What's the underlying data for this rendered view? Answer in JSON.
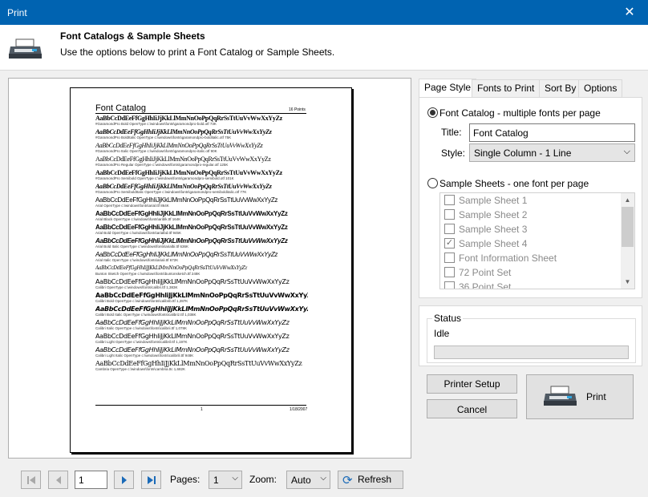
{
  "window": {
    "title": "Print"
  },
  "header": {
    "title": "Font Catalogs & Sample Sheets",
    "subtitle": "Use the options below to print a Font Catalog or Sample Sheets."
  },
  "preview": {
    "catalog_title": "Font Catalog",
    "catalog_points": "16 Points",
    "footer_page": "1",
    "footer_date": "1/18/2007",
    "entries": [
      {
        "sample": "AaBbCcDdEeFfGgHhIiJjKkLlMmNnOoPpQqRrSsTtUuVvWwXxYyZz",
        "meta": "#GaramondPro Bold    OpenType    c:\\windows\\fonts\\garamondpro-bold.otf    73K"
      },
      {
        "sample": "AaBbCcDdEeFfGgHhIiJjKkLlMmNnOoPpQqRrSsTtUuVvWwXxYyZz",
        "meta": "#GaramondPro BoldItalic    OpenType    c:\\windows\\fonts\\garamondpro-bolditalic.otf    75K"
      },
      {
        "sample": "AaBbCcDdEeFfGgHhIiJjKkLlMmNnOoPpQqRrSsTtUuVvWwXxYyZz",
        "meta": "#GaramondPro Italic    OpenType    c:\\windows\\fonts\\garamondpro-italic.otf    90K"
      },
      {
        "sample": "AaBbCcDdEeFfGgHhIiJjKkLlMmNnOoPpQqRrSsTtUuVvWwXxYyZz",
        "meta": "#GaramondPro Regular    OpenType    c:\\windows\\fonts\\garamondpro-regular.otf    125K"
      },
      {
        "sample": "AaBbCcDdEeFfGgHhIiJjKkLlMmNnOoPpQqRrSsTtUuVvWwXxYyZz",
        "meta": "#GaramondPro Semibold    OpenType    c:\\windows\\fonts\\garamondpro-semibold.otf    101K"
      },
      {
        "sample": "AaBbCcDdEeFfGgHhIiJjKkLlMmNnOoPpQqRrSsTtUuVvWwXxYyZz",
        "meta": "#GaramondPro SemiboldItalic    OpenType    c:\\windows\\fonts\\garamondpro-semibolditalic.otf    77K"
      },
      {
        "sample": "AaBbCcDdEeFfGgHhIiJjKkLlMmNnOoPpQqRrSsTtUuVvWwXxYyZz",
        "meta": "Arial    OpenType    c:\\windows\\fonts\\arial.ttf    864K"
      },
      {
        "sample": "AaBbCcDdEeFfGgHhIiJjKkLlMmNnOoPpQqRrSsTtUuVvWwXxYyZz",
        "meta": "Arial Black    OpenType    c:\\windows\\fonts\\ariblk.ttf    164K"
      },
      {
        "sample": "AaBbCcDdEeFfGgHhIiJjKkLlMmNnOoPpQqRrSsTtUuVvWwXxYyZz",
        "meta": "Arial Bold    OpenType    c:\\windows\\fonts\\arialbd.ttf    945K"
      },
      {
        "sample": "AaBbCcDdEeFfGgHhIiJjKkLlMmNnOoPpQqRrSsTtUuVvWwXxYyZz",
        "meta": "Arial Bold Italic    OpenType    c:\\windows\\fonts\\arialbi.ttf    636K"
      },
      {
        "sample": "AaBbCcDdEeFfGgHhIiJjKkLlMmNnOoPpQqRrSsTtUuVvWwXxYyZz",
        "meta": "Arial Italic    OpenType    c:\\windows\\fonts\\ariali.ttf    672K"
      },
      {
        "sample": "AaBbCcDdEeFfGgHhIiJjKkLlMmNnOoPpQqRrSsTtUuVvWwXxYyZz",
        "meta": "Bunton Sketch    OpenType    c:\\windows\\fonts\\buntonsketch.ttf    248K"
      },
      {
        "sample": "AaBbCcDdEeFfGgHhIiJjKkLlMmNnOoPpQqRrSsTtUuVvWwXxYyZz",
        "meta": "Calibri    OpenType    c:\\windows\\fonts\\calibri.ttf    1,383K"
      },
      {
        "sample": "AaBbCcDdEeFfGgHhIiJjKkLlMmNnOoPpQqRrSsTtUuVvWwXxYyZz",
        "meta": "Calibri Bold    OpenType    c:\\windows\\fonts\\calibrib.ttf    1,287K"
      },
      {
        "sample": "AaBbCcDdEeFfGgHhIiJjKkLlMmNnOoPpQqRrSsTtUuVvWwXxYyZz",
        "meta": "Calibri Bold Italic    OpenType    c:\\windows\\fonts\\calibriz.ttf    1,038K"
      },
      {
        "sample": "AaBbCcDdEeFfGgHhIiJjKkLlMmNnOoPpQqRrSsTtUuVvWwXxYyZz",
        "meta": "Calibri Italic    OpenType    c:\\windows\\fonts\\calibrii.ttf    1,078K"
      },
      {
        "sample": "AaBbCcDdEeFfGgHhIiJjKkLlMmNnOoPpQqRrSsTtUuVvWwXxYyZz",
        "meta": "Calibri Light    OpenType    c:\\windows\\fonts\\calibril.ttf    1,197K"
      },
      {
        "sample": "AaBbCcDdEeFfGgHhIiJjKkLlMmNnOoPpQqRrSsTtUuVvWwXxYyZz",
        "meta": "Calibri Light Italic    OpenType    c:\\windows\\fonts\\calibrili.ttf    948K"
      },
      {
        "sample": "AaBbCcDdEeFfGgHhIiJjKkLlMmNnOoPpQqRrSsTtUuVvWwXxYyZz",
        "meta": "Cambria    OpenType    c:\\windows\\fonts\\cambria.ttc    1,682K"
      }
    ]
  },
  "bottom": {
    "page_value": "1",
    "pages_label": "Pages:",
    "pages_value": "1",
    "zoom_label": "Zoom:",
    "zoom_value": "Auto",
    "refresh_label": "Refresh"
  },
  "tabs": [
    "Page Style",
    "Fonts to Print",
    "Sort By",
    "Options"
  ],
  "page_style": {
    "catalog_option": "Font Catalog - multiple fonts per page",
    "title_label": "Title:",
    "title_value": "Font Catalog",
    "style_label": "Style:",
    "style_value": "Single Column - 1 Line",
    "sheets_option": "Sample Sheets - one font per page",
    "sheets": [
      {
        "label": "Sample Sheet 1",
        "checked": false
      },
      {
        "label": "Sample Sheet 2",
        "checked": false
      },
      {
        "label": "Sample Sheet 3",
        "checked": false
      },
      {
        "label": "Sample Sheet 4",
        "checked": true
      },
      {
        "label": "Font Information Sheet",
        "checked": false
      },
      {
        "label": "72 Point Set",
        "checked": false
      },
      {
        "label": "36 Point Set",
        "checked": false
      }
    ]
  },
  "status": {
    "label": "Status",
    "text": "Idle",
    "progress": 0
  },
  "actions": {
    "printer_setup": "Printer Setup",
    "cancel": "Cancel",
    "print": "Print"
  },
  "colors": {
    "titlebar": "#0063b1",
    "nav_accent": "#1a6ab8"
  }
}
